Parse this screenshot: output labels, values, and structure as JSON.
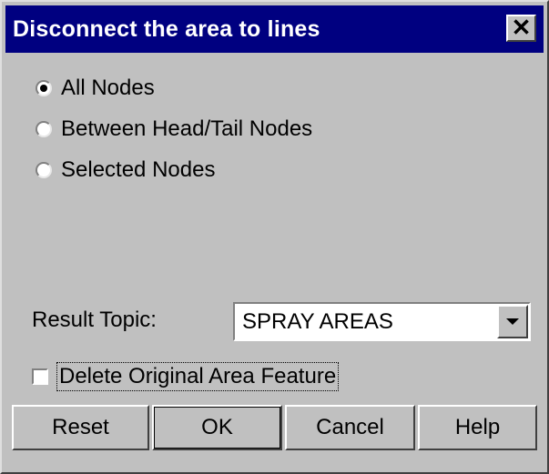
{
  "dialog": {
    "title": "Disconnect the area to lines",
    "close_symbol": "✕"
  },
  "node_options": [
    {
      "label": "All Nodes",
      "selected": true
    },
    {
      "label": "Between Head/Tail Nodes",
      "selected": false
    },
    {
      "label": "Selected Nodes",
      "selected": false
    }
  ],
  "result_topic": {
    "label": "Result Topic:",
    "value": "SPRAY AREAS"
  },
  "delete_original": {
    "label": "Delete Original Area Feature",
    "checked": false
  },
  "buttons": {
    "reset": "Reset",
    "ok": "OK",
    "cancel": "Cancel",
    "help": "Help"
  },
  "colors": {
    "titlebar": "#000080",
    "face": "#c0c0c0"
  },
  "icons": {
    "close": "close-icon",
    "dropdown": "chevron-down-icon"
  }
}
